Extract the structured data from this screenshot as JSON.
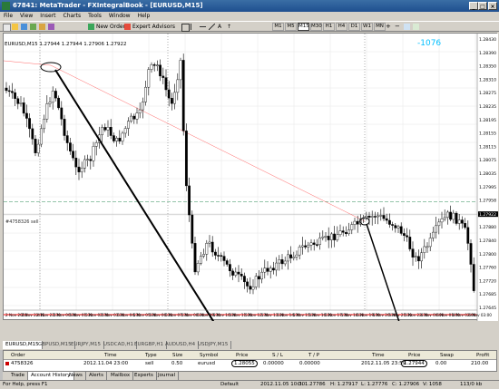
{
  "window": {
    "title": "67841: MetaTrader - FXIntegralBook - [EURUSD,M15]"
  },
  "menu": [
    "File",
    "View",
    "Insert",
    "Charts",
    "Tools",
    "Window",
    "Help"
  ],
  "toolbar": {
    "new_order": "New Order",
    "expert_advisors": "Expert Advisors",
    "timeframes": [
      "M1",
      "M5",
      "M15",
      "M30",
      "H1",
      "H4",
      "D1",
      "W1",
      "MN"
    ]
  },
  "chart": {
    "header": "EURUSD,M15  1.27944 1.27944 1.27906 1.27922",
    "overlay_label": "-1076",
    "order_line_label": "#4758326 sell",
    "price_scale": [
      "1.28430",
      "1.28390",
      "1.28350",
      "1.28310",
      "1.28275",
      "1.28235",
      "1.28195",
      "1.28155",
      "1.28115",
      "1.28075",
      "1.28035",
      "1.27995",
      "1.27958",
      "1.27922",
      "1.27880",
      "1.27840",
      "1.27800",
      "1.27760",
      "1.27720",
      "1.27685",
      "1.27645"
    ],
    "time_scale": [
      "2 Nov 2012",
      "2 Nov 22:15",
      "4 Nov 22:30",
      "5 Nov 00:30",
      "5 Nov 01:30",
      "5 Nov 02:30",
      "5 Nov 03:30",
      "5 Nov 04:30",
      "5 Nov 05:30",
      "5 Nov 06:30",
      "5 Nov 07:30",
      "5 Nov 08:30",
      "5 Nov 09:30",
      "5 Nov 10:30",
      "5 Nov 11:30",
      "5 Nov 12:30",
      "5 Nov 13:30",
      "5 Nov 14:30",
      "5 Nov 15:30",
      "5 Nov 16:30",
      "5 Nov 17:30",
      "5 Nov 18:30",
      "5 Nov 19:30",
      "5 Nov 20:30",
      "5 Nov 21:30",
      "5 Nov 22:30",
      "6 Nov 00:00",
      "6 Nov 01:00",
      "6 Nov 02:00",
      "6 Nov 03:00"
    ],
    "bid_price": "1.27922",
    "colors": {
      "bull": "#ffffff",
      "bear": "#000000",
      "order_line": "#2e8b57",
      "red_line": "#ff0000",
      "trend": "#ff6666"
    }
  },
  "chart_tabs": [
    "EURUSD,M15",
    "GBPUSD,M15",
    "EURJPY,M15",
    "USDCAD,H1",
    "EURGBP,H1",
    "AUDUSD,H4",
    "USDJPY,M15"
  ],
  "terminal": {
    "headers": [
      "Order",
      "Time",
      "Type",
      "Size",
      "Symbol",
      "Price",
      "S / L",
      "T / P",
      "Time",
      "Price",
      "Swap",
      "Profit"
    ],
    "row": [
      "4758326",
      "2012.11.04 23:00",
      "sell",
      "0.50",
      "eurusd",
      "1.28055",
      "0.00000",
      "0.00000",
      "2012.11.05 23:59",
      "1.27944",
      "0.00",
      "210.00"
    ]
  },
  "terminal_tabs": [
    "Trade",
    "Account History",
    "News",
    "Alerts",
    "Mailbox",
    "Experts",
    "Journal"
  ],
  "status": {
    "help": "For Help, press F1",
    "profile": "Default",
    "datetime": "2012.11.05 10:30",
    "open": "O: 1.27786",
    "high": "H: 1.27917",
    "low": "L: 1.27776",
    "close": "C: 1.27906",
    "volume": "V: 1058",
    "traffic": "113/0 kb"
  }
}
